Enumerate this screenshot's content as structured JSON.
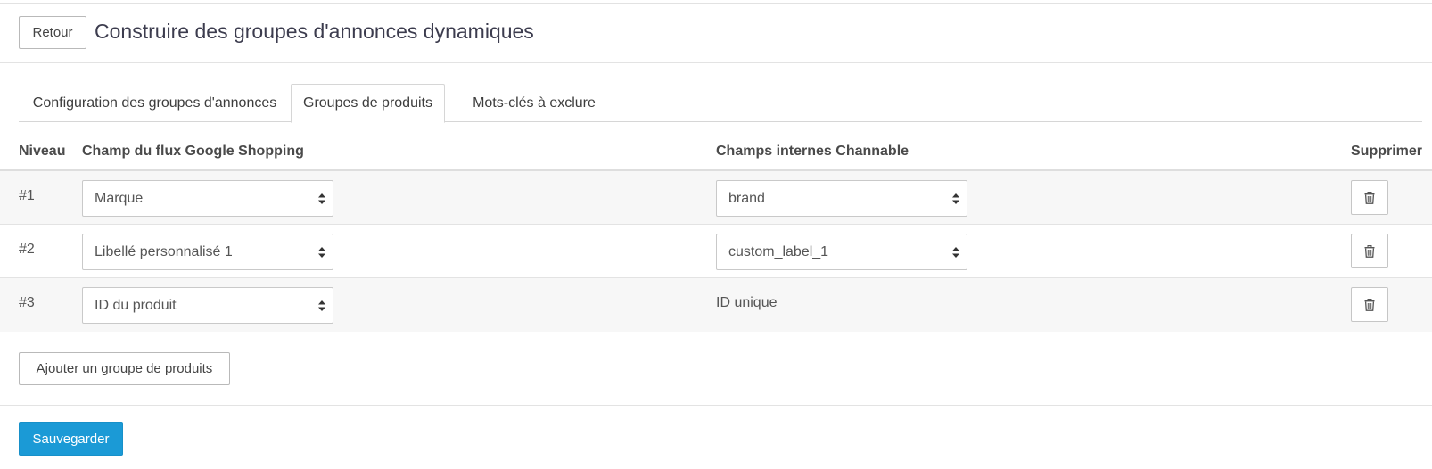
{
  "header": {
    "back_label": "Retour",
    "title": "Construire des groupes d'annonces dynamiques"
  },
  "tabs": [
    {
      "label": "Configuration des groupes d'annonces",
      "active": false
    },
    {
      "label": "Groupes de produits",
      "active": true
    },
    {
      "label": "Mots-clés à exclure",
      "active": false
    }
  ],
  "table": {
    "headers": {
      "level": "Niveau",
      "field": "Champ du flux Google Shopping",
      "internal": "Champs internes Channable",
      "delete": "Supprimer"
    },
    "rows": [
      {
        "level": "#1",
        "field": "Marque",
        "internal": "brand",
        "internal_is_select": true
      },
      {
        "level": "#2",
        "field": "Libellé personnalisé 1",
        "internal": "custom_label_1",
        "internal_is_select": true
      },
      {
        "level": "#3",
        "field": "ID du produit",
        "internal": "ID unique",
        "internal_is_select": false
      }
    ]
  },
  "actions": {
    "add_label": "Ajouter un groupe de produits",
    "save_label": "Sauvegarder"
  },
  "colors": {
    "primary": "#1b9ad6",
    "title": "#3c3c4e",
    "row_alt": "#f7f7f7"
  },
  "icons": {
    "select_caret": "sort-caret-icon",
    "delete": "trash-icon"
  }
}
